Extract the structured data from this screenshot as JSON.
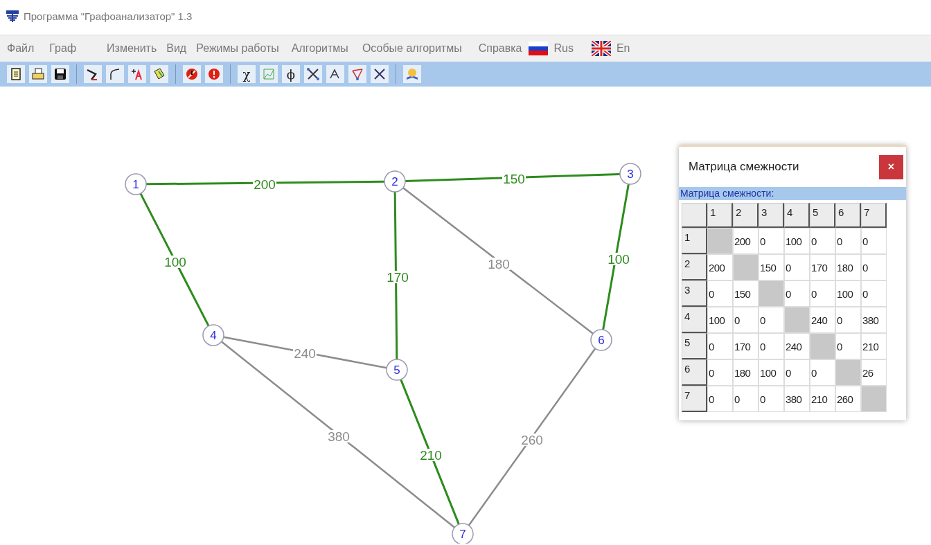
{
  "window": {
    "title": "Программа \"Графоанализатор\" 1.3"
  },
  "menu": [
    {
      "kind": "item",
      "label": "Файл"
    },
    {
      "kind": "item",
      "label": "Граф"
    },
    {
      "kind": "item",
      "label": "Изменить"
    },
    {
      "kind": "item",
      "label": "Вид"
    },
    {
      "kind": "item",
      "label": "Режимы работы"
    },
    {
      "kind": "item",
      "label": "Алгоритмы"
    },
    {
      "kind": "item",
      "label": "Особые алгоритмы"
    },
    {
      "kind": "item",
      "label": "Справка"
    },
    {
      "kind": "lang",
      "label": "Rus"
    },
    {
      "kind": "lang",
      "label": "En"
    }
  ],
  "toolbar": [
    {
      "kind": "icon"
    },
    {
      "kind": "icon"
    },
    {
      "kind": "icon"
    },
    {
      "kind": "separator"
    },
    {
      "kind": "icon"
    },
    {
      "kind": "icon"
    },
    {
      "kind": "icon"
    },
    {
      "kind": "icon"
    },
    {
      "kind": "separator"
    },
    {
      "kind": "icon"
    },
    {
      "kind": "icon"
    },
    {
      "kind": "separator"
    },
    {
      "kind": "glyph",
      "text": "χ"
    },
    {
      "kind": "icon"
    },
    {
      "kind": "glyph",
      "text": "ϕ"
    },
    {
      "kind": "icon"
    },
    {
      "kind": "icon"
    },
    {
      "kind": "icon"
    },
    {
      "kind": "icon"
    },
    {
      "kind": "separator"
    },
    {
      "kind": "icon"
    }
  ],
  "graph": {
    "nodes": [
      {
        "label": "1"
      },
      {
        "label": "2"
      },
      {
        "label": "3"
      },
      {
        "label": "4"
      },
      {
        "label": "5"
      },
      {
        "label": "6"
      },
      {
        "label": "7"
      }
    ],
    "edges": [
      {
        "weight": "200",
        "highlighted": true
      },
      {
        "weight": "150",
        "highlighted": true
      },
      {
        "weight": "100",
        "highlighted": true
      },
      {
        "weight": "170",
        "highlighted": true
      },
      {
        "weight": "180",
        "highlighted": false
      },
      {
        "weight": "100",
        "highlighted": true
      },
      {
        "weight": "240",
        "highlighted": false
      },
      {
        "weight": "380",
        "highlighted": false
      },
      {
        "weight": "210",
        "highlighted": true
      },
      {
        "weight": "260",
        "highlighted": false
      }
    ]
  },
  "matrix_window": {
    "title": "Матрица смежности",
    "close": "×",
    "caption": "Матрица смежности:",
    "columns": [
      "1",
      "2",
      "3",
      "4",
      "5",
      "6",
      "7"
    ],
    "rows": [
      {
        "label": "1",
        "cells": [
          null,
          "200",
          "0",
          "100",
          "0",
          "0",
          "0"
        ]
      },
      {
        "label": "2",
        "cells": [
          "200",
          null,
          "150",
          "0",
          "170",
          "180",
          "0"
        ]
      },
      {
        "label": "3",
        "cells": [
          "0",
          "150",
          null,
          "0",
          "0",
          "100",
          "0"
        ]
      },
      {
        "label": "4",
        "cells": [
          "100",
          "0",
          "0",
          null,
          "240",
          "0",
          "380"
        ]
      },
      {
        "label": "5",
        "cells": [
          "0",
          "170",
          "0",
          "240",
          null,
          "0",
          "210"
        ]
      },
      {
        "label": "6",
        "cells": [
          "0",
          "180",
          "100",
          "0",
          "0",
          null,
          "26"
        ]
      },
      {
        "label": "7",
        "cells": [
          "0",
          "0",
          "0",
          "380",
          "210",
          "260",
          null
        ]
      }
    ]
  }
}
